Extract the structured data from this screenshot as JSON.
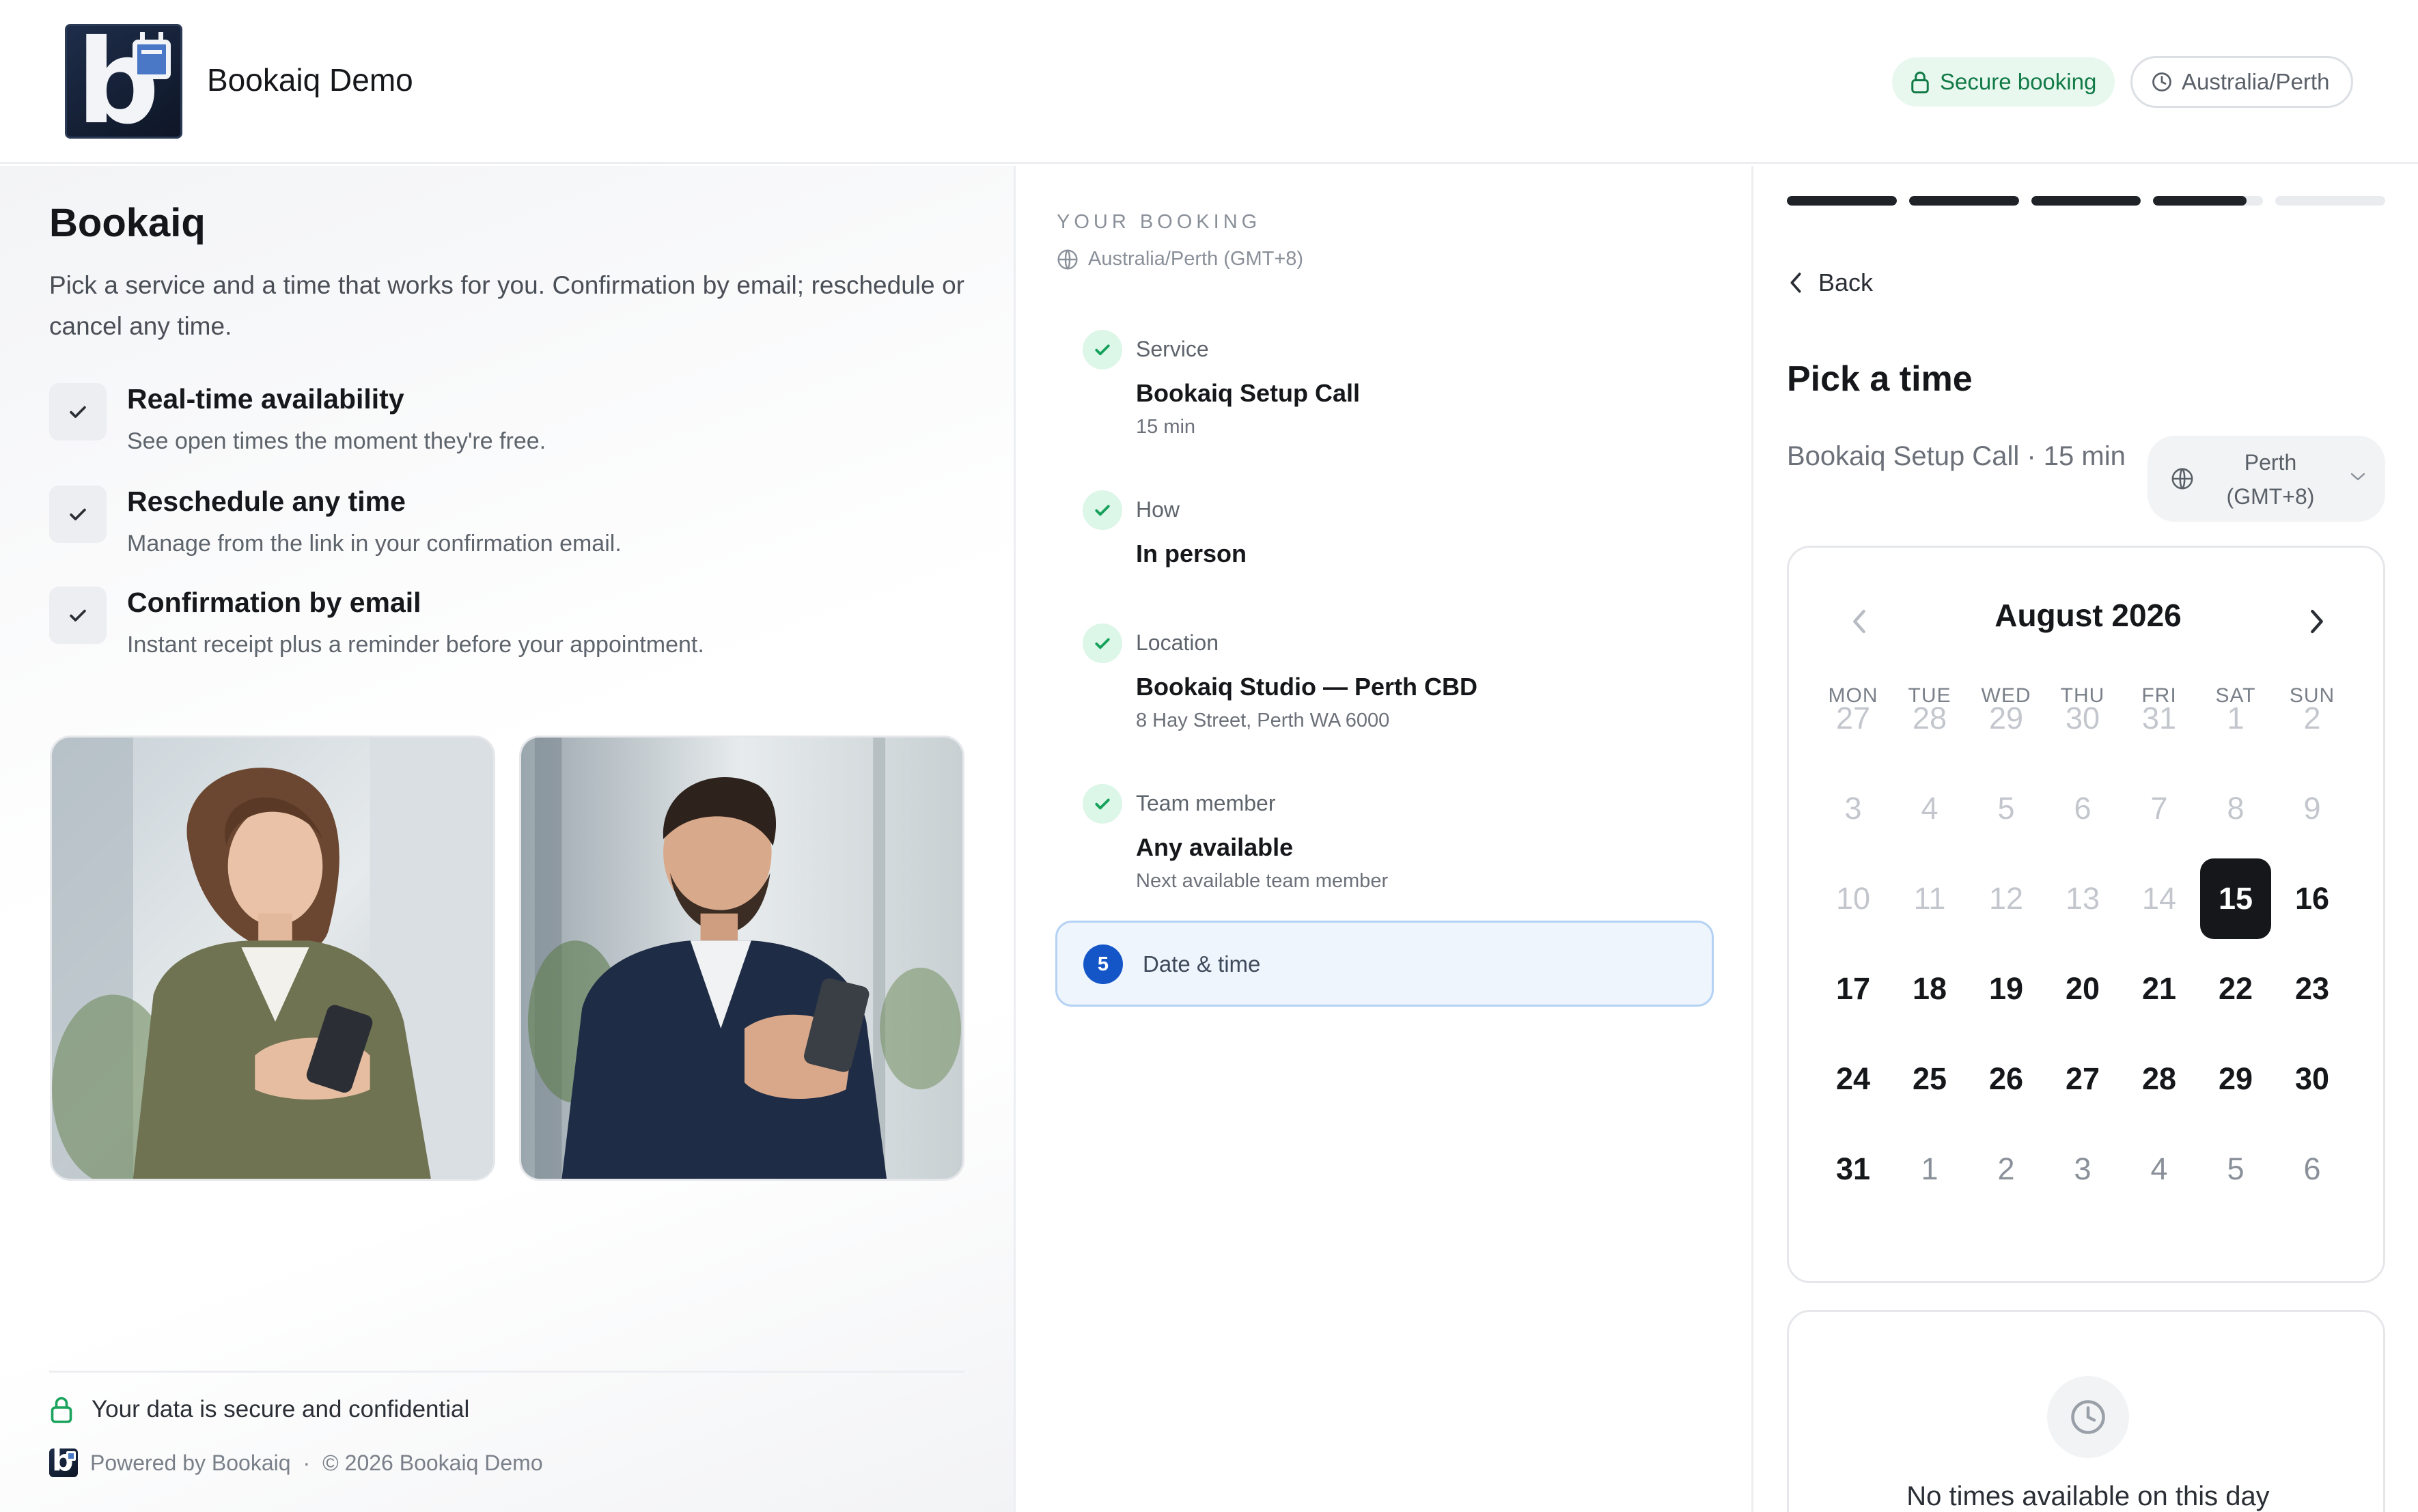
{
  "header": {
    "brand_name": "Bookaiq Demo",
    "secure_label": "Secure booking",
    "timezone_label": "Australia/Perth"
  },
  "intro": {
    "title": "Bookaiq",
    "description": "Pick a service and a time that works for you. Confirmation by email; reschedule or cancel any time.",
    "features": [
      {
        "title": "Real-time availability",
        "desc": "See open times the moment they're free."
      },
      {
        "title": "Reschedule any time",
        "desc": "Manage from the link in your confirmation email."
      },
      {
        "title": "Confirmation by email",
        "desc": "Instant receipt plus a reminder before your appointment."
      }
    ],
    "secure_note": "Your data is secure and confidential",
    "powered_by": "Powered by Bookaiq",
    "separator": "·",
    "copyright": "© 2026 Bookaiq Demo"
  },
  "summary": {
    "label": "YOUR BOOKING",
    "timezone": "Australia/Perth (GMT+8)",
    "steps": [
      {
        "label": "Service",
        "value": "Bookaiq Setup Call",
        "sub": "15 min"
      },
      {
        "label": "How",
        "value": "In person",
        "sub": ""
      },
      {
        "label": "Location",
        "value": "Bookaiq Studio — Perth CBD",
        "sub": "8 Hay Street, Perth WA 6000"
      },
      {
        "label": "Team member",
        "value": "Any available",
        "sub": "Next available team member"
      }
    ],
    "active_step": {
      "number": "5",
      "label": "Date & time"
    }
  },
  "picker": {
    "progress": [
      1,
      1,
      1,
      0.85,
      0
    ],
    "back_label": "Back",
    "title": "Pick a time",
    "service_line": "Bookaiq Setup Call · 15 min",
    "timezone_select": "Perth (GMT+8)",
    "month_label": "August 2026",
    "weekdays": [
      "MON",
      "TUE",
      "WED",
      "THU",
      "FRI",
      "SAT",
      "SUN"
    ],
    "weeks": [
      [
        "27",
        "28",
        "29",
        "30",
        "31",
        "1",
        "2"
      ],
      [
        "3",
        "4",
        "5",
        "6",
        "7",
        "8",
        "9"
      ],
      [
        "10",
        "11",
        "12",
        "13",
        "14",
        "15",
        "16"
      ],
      [
        "17",
        "18",
        "19",
        "20",
        "21",
        "22",
        "23"
      ],
      [
        "24",
        "25",
        "26",
        "27",
        "28",
        "29",
        "30"
      ],
      [
        "31",
        "1",
        "2",
        "3",
        "4",
        "5",
        "6"
      ]
    ],
    "selected_day": "15",
    "no_times": "No times available on this day"
  },
  "colors": {
    "accent_blue": "#1456c8",
    "success_green": "#117a47",
    "selected_day": "#15171a"
  }
}
